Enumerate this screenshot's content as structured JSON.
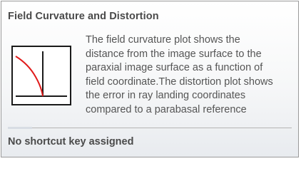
{
  "tooltip": {
    "title": "Field Curvature and Distortion",
    "description_lines": [
      "The field curvature plot shows the",
      "distance from the image surface to the",
      "paraxial image surface as a function of",
      "field coordinate.The distortion plot shows",
      "the error in ray landing coordinates",
      "compared to a parabasal reference"
    ],
    "shortcut_text": "No shortcut key assigned",
    "icon": "field-curvature-plot-icon"
  },
  "colors": {
    "curve": "#e01b1b",
    "axes": "#1a1a1a",
    "border": "#9a9a9a"
  }
}
